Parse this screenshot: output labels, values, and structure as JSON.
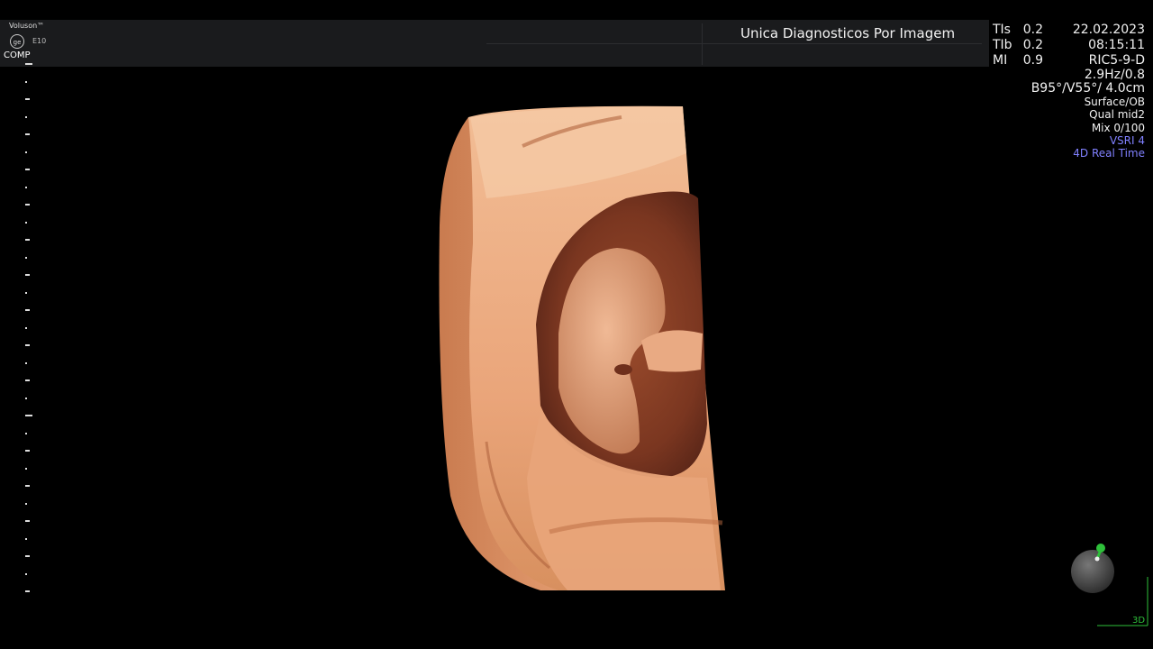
{
  "header": {
    "brand": "Voluson™",
    "model": "E10",
    "mode": "COMP",
    "clinic": "Unica Diagnosticos Por Imagem"
  },
  "params": [
    {
      "label": "TIs",
      "value": "0.2"
    },
    {
      "label": "TIb",
      "value": "0.2"
    },
    {
      "label": "MI",
      "value": "0.9"
    }
  ],
  "info": {
    "date": "22.02.2023",
    "time": "08:15:11",
    "probe": "RIC5-9-D",
    "freq": "2.9Hz/0.8",
    "angle": "B95°/V55°/ 4.0cm",
    "render_mode": "Surface/OB",
    "quality": "Qual mid2",
    "mix": "Mix 0/100",
    "vsri": "VSRI 4",
    "mode4d": "4D Real Time"
  },
  "view_label": "3D",
  "colors": {
    "tissue": "#e7a176",
    "tissue_dark": "#b86b45",
    "accent_blue": "#8080ff",
    "orient_green": "#2ec03a"
  },
  "icons": {
    "ge_logo": "ge-logo-icon",
    "orientation": "orientation-sphere-icon"
  }
}
